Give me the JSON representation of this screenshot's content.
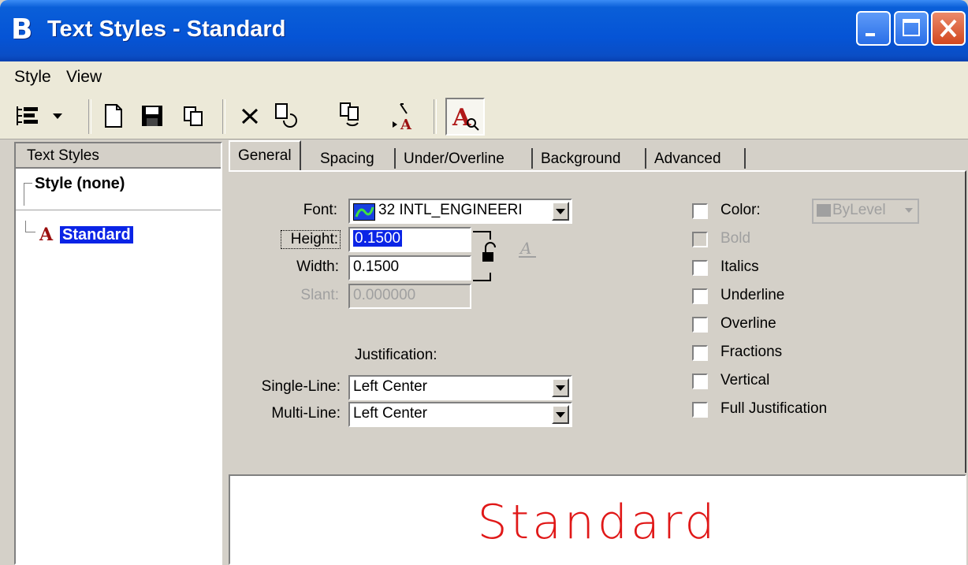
{
  "window": {
    "title": "Text Styles - Standard",
    "app_icon": "microstation-b-icon",
    "controls": [
      "minimize-icon",
      "maximize-icon",
      "close-icon"
    ]
  },
  "menu": {
    "items": [
      "Style",
      "View"
    ]
  },
  "toolbar": {
    "icons": [
      "tree-view-icon",
      "dropdown-arrow-icon",
      "new-style-icon",
      "save-icon",
      "copy-icon",
      "delete-icon",
      "reset-icon",
      "update-from-style-icon",
      "import-icon",
      "preview-text-icon"
    ]
  },
  "left_panel": {
    "header": "Text Styles",
    "nodes": [
      {
        "label": "Style (none)"
      },
      {
        "label": "Standard",
        "selected": true,
        "icon": "text-style-icon"
      }
    ]
  },
  "tabs": {
    "items": [
      "General",
      "Spacing",
      "Under/Overline",
      "Background",
      "Advanced"
    ],
    "active": "General"
  },
  "general": {
    "font_label": "Font:",
    "font_value": "32  INTL_ENGINEERI",
    "font_icon": "font-type-icon",
    "height_label": "Height:",
    "height_value": "0.1500",
    "width_label": "Width:",
    "width_value": "0.1500",
    "slant_label": "Slant:",
    "slant_value": "0.000000",
    "lock_icon": "lock-icon",
    "underline_a_icon": "underline-a-icon",
    "justification_label": "Justification:",
    "single_line_label": "Single-Line:",
    "single_line_value": "Left Center",
    "multi_line_label": "Multi-Line:",
    "multi_line_value": "Left Center",
    "color_label": "Color:",
    "color_value": "ByLevel",
    "checkboxes": [
      {
        "label": "Color:",
        "checked": false,
        "enabled": true
      },
      {
        "label": "Bold",
        "checked": false,
        "enabled": false
      },
      {
        "label": "Italics",
        "checked": false,
        "enabled": true
      },
      {
        "label": "Underline",
        "checked": false,
        "enabled": true
      },
      {
        "label": "Overline",
        "checked": false,
        "enabled": true
      },
      {
        "label": "Fractions",
        "checked": false,
        "enabled": true
      },
      {
        "label": "Vertical",
        "checked": false,
        "enabled": true
      },
      {
        "label": "Full Justification",
        "checked": false,
        "enabled": true
      }
    ]
  },
  "preview": {
    "text": "Standard",
    "color": "#e01818"
  }
}
